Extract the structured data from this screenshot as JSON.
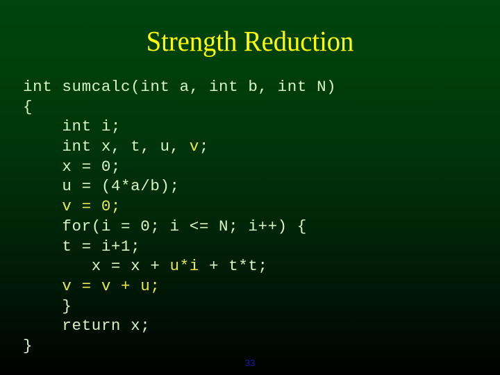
{
  "slide": {
    "title": "Strength Reduction",
    "page_number": "33",
    "background_top_color": "#00450c",
    "background_bottom_color": "#000000",
    "title_color": "#ffff00",
    "code_color": "#d8f3c4",
    "highlight_color": "#e9e94a",
    "page_number_color": "#1b1b9e"
  },
  "code": {
    "language": "c",
    "lines": [
      {
        "indent": "",
        "segments": [
          {
            "text": "int sumcalc(int a, int b, int N)",
            "highlight": false
          }
        ]
      },
      {
        "indent": "",
        "segments": [
          {
            "text": "{",
            "highlight": false
          }
        ]
      },
      {
        "indent": "    ",
        "segments": [
          {
            "text": "int i;",
            "highlight": false
          }
        ]
      },
      {
        "indent": "    ",
        "segments": [
          {
            "text": "int x, t, u, ",
            "highlight": false
          },
          {
            "text": "v",
            "highlight": true
          },
          {
            "text": ";",
            "highlight": false
          }
        ]
      },
      {
        "indent": "    ",
        "segments": [
          {
            "text": "x = 0;",
            "highlight": false
          }
        ]
      },
      {
        "indent": "    ",
        "segments": [
          {
            "text": "u = (4*a/b);",
            "highlight": false
          }
        ]
      },
      {
        "indent": "    ",
        "segments": [
          {
            "text": "v = 0;",
            "highlight": true
          }
        ]
      },
      {
        "indent": "    ",
        "segments": [
          {
            "text": "for(i = 0; i <= N; i++) {",
            "highlight": false
          }
        ]
      },
      {
        "indent": "   ",
        "segments": [
          {
            "text": " t = i+1;",
            "highlight": false
          }
        ]
      },
      {
        "indent": "      ",
        "segments": [
          {
            "text": " x = x + ",
            "highlight": false
          },
          {
            "text": "u*i",
            "highlight": true
          },
          {
            "text": " + t*t;",
            "highlight": false
          }
        ]
      },
      {
        "indent": "   ",
        "segments": [
          {
            "text": " v = v + u;",
            "highlight": true
          }
        ]
      },
      {
        "indent": "    ",
        "segments": [
          {
            "text": "}",
            "highlight": false
          }
        ]
      },
      {
        "indent": "    ",
        "segments": [
          {
            "text": "return x;",
            "highlight": false
          }
        ]
      },
      {
        "indent": "",
        "segments": [
          {
            "text": "}",
            "highlight": false
          }
        ]
      }
    ],
    "plain_text": "int sumcalc(int a, int b, int N)\n{\n    int i;\n    int x, t, u, v;\n    x = 0;\n    u = (4*a/b);\n    v = 0;\n    for(i = 0; i <= N; i++) {\n     t = i+1;\n       x = x + u*i + t*t;\n     v = v + u;\n    }\n    return x;\n}"
  }
}
